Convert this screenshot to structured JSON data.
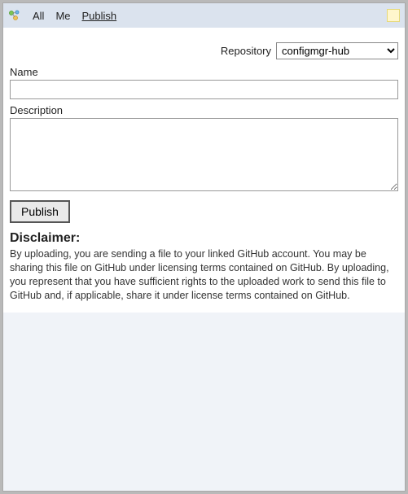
{
  "toolbar": {
    "tabs": [
      "All",
      "Me",
      "Publish"
    ],
    "active_tab_index": 2
  },
  "form": {
    "repository_label": "Repository",
    "repository_options": [
      "configmgr-hub"
    ],
    "repository_selected": "configmgr-hub",
    "name_label": "Name",
    "name_value": "",
    "description_label": "Description",
    "description_value": "",
    "publish_button": "Publish"
  },
  "disclaimer": {
    "heading": "Disclaimer:",
    "body": "By uploading, you are sending a file to your linked GitHub account. You may be sharing this file on GitHub under licensing terms contained on GitHub. By uploading, you represent that you have sufficient rights to the uploaded work to send this file to GitHub and, if applicable, share it under license terms contained on GitHub."
  }
}
